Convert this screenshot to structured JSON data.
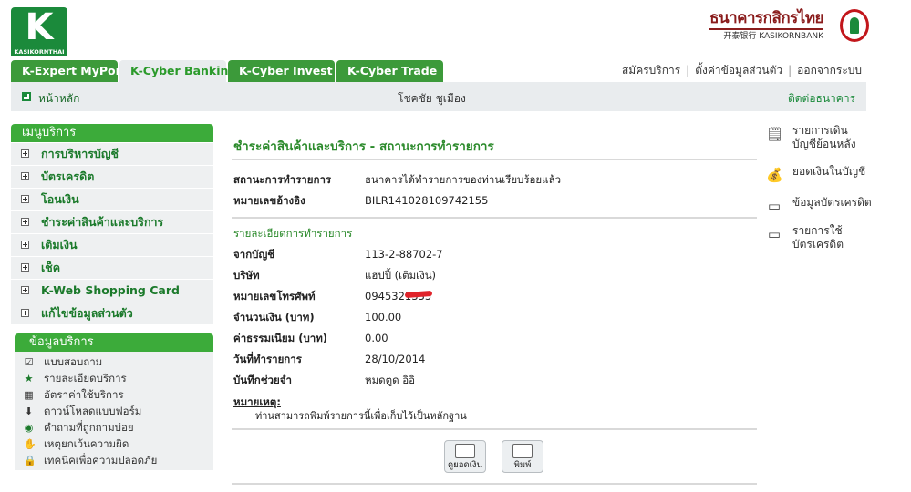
{
  "brand": {
    "logo_letter": "K",
    "logo_text": "KASIKORNTHAI",
    "bank_name_th": "ธนาคารกสิกรไทย",
    "bank_name_en": "开泰银行 KASIKORNBANK"
  },
  "tabs": [
    {
      "label": "K-Expert MyPort"
    },
    {
      "label": "K-Cyber Banking"
    },
    {
      "label": "K-Cyber Invest"
    },
    {
      "label": "K-Cyber Trade"
    }
  ],
  "top_links": [
    "สมัครบริการ",
    "ตั้งค่าข้อมูลส่วนตัว",
    "ออกจากระบบ"
  ],
  "bar": {
    "home": "หน้าหลัก",
    "user_name": "โชคชัย ชูเมือง",
    "contact": "ติดต่อธนาคาร"
  },
  "menu": {
    "header": "เมนูบริการ",
    "items": [
      "การบริหารบัญชี",
      "บัตรเครดิต",
      "โอนเงิน",
      "ชำระค่าสินค้าและบริการ",
      "เติมเงิน",
      "เช็ค",
      "K-Web Shopping Card",
      "แก้ไขข้อมูลส่วนตัว"
    ]
  },
  "info": {
    "header": "ข้อมูลบริการ",
    "items": [
      {
        "label": "แบบสอบถาม",
        "icon": "checkbox-icon"
      },
      {
        "label": "รายละเอียดบริการ",
        "icon": "star-icon"
      },
      {
        "label": "อัตราค่าใช้บริการ",
        "icon": "calculator-icon"
      },
      {
        "label": "ดาวน์โหลดแบบฟอร์ม",
        "icon": "download-icon"
      },
      {
        "label": "คำถามที่ถูกถามบ่อย",
        "icon": "question-icon"
      },
      {
        "label": "เหตุยกเว้นความผิด",
        "icon": "hand-icon"
      },
      {
        "label": "เทคนิคเพื่อความปลอดภัย",
        "icon": "lock-icon"
      }
    ]
  },
  "main": {
    "title": "ชำระค่าสินค้าและบริการ - สถานะการทำรายการ",
    "status_label": "สถานะการทำรายการ",
    "status_value": "ธนาคารได้ทำรายการของท่านเรียบร้อยแล้ว",
    "ref_label": "หมายเลขอ้างอิง",
    "ref_value": "BILR141028109742155",
    "details_header": "รายละเอียดการทำรายการ",
    "details": [
      {
        "label": "จากบัญชี",
        "value": "113-2-88702-7"
      },
      {
        "label": "บริษัท",
        "value": "แฮปปี้ (เติมเงิน)"
      },
      {
        "label": "หมายเลขโทรศัพท์",
        "value": "0945321335"
      },
      {
        "label": "จำนวนเงิน (บาท)",
        "value": "100.00"
      },
      {
        "label": "ค่าธรรมเนียม (บาท)",
        "value": "0.00"
      },
      {
        "label": "วันที่ทำรายการ",
        "value": "28/10/2014"
      },
      {
        "label": "บันทึกช่วยจำ",
        "value": "หมดตูด อิอิ"
      }
    ],
    "note_label": "หมายเหตุ:",
    "note_text": "ท่านสามารถพิมพ์รายการนี้เพื่อเก็บไว้เป็นหลักฐาน",
    "buttons": [
      {
        "label": "ดูยอดเงิน",
        "icon": "balance-icon"
      },
      {
        "label": "พิมพ์",
        "icon": "printer-icon"
      }
    ]
  },
  "right_links": [
    {
      "line1": "รายการเดิน",
      "line2": "บัญชีย้อนหลัง",
      "icon": "statement-icon"
    },
    {
      "line1": "ยอดเงินในบัญชี",
      "line2": "",
      "icon": "money-bag-icon"
    },
    {
      "line1": "ข้อมูลบัตรเครดิต",
      "line2": "",
      "icon": "credit-card-icon"
    },
    {
      "line1": "รายการใช้",
      "line2": "บัตรเครดิต",
      "icon": "card-usage-icon"
    }
  ]
}
